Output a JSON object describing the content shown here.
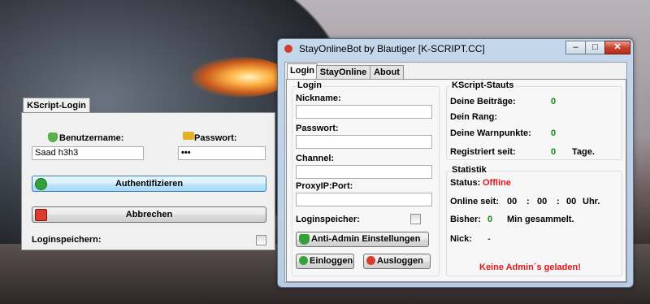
{
  "login_dialog": {
    "tab": "KScript-Login",
    "username_label": "Benutzername:",
    "username_value": "Saad h3h3",
    "password_label": "Passwort:",
    "password_value": "•••",
    "auth_button": "Authentifizieren",
    "cancel_button": "Abbrechen",
    "remember_label": "Loginspeichern:"
  },
  "bot_window": {
    "title": "StayOnlineBot by Blautiger [K-SCRIPT.CC]",
    "controls": {
      "minimize": "–",
      "maximize": "□",
      "close": "✕"
    },
    "tabs": [
      "Login",
      "StayOnline",
      "About"
    ],
    "login_group": {
      "title": "Login",
      "nickname_label": "Nickname:",
      "password_label": "Passwort:",
      "channel_label": "Channel:",
      "proxy_label": "ProxyIP:Port:",
      "remember_label": "Loginspeicher:",
      "anti_admin_button": "Anti-Admin Einstellungen",
      "login_button": "Einloggen",
      "logout_button": "Ausloggen"
    },
    "status_group": {
      "title": "KScript-Stauts",
      "posts_label": "Deine Beiträge:",
      "posts_value": "0",
      "rank_label": "Dein Rang:",
      "warn_label": "Deine Warnpunkte:",
      "warn_value": "0",
      "registered_label": "Registriert seit:",
      "registered_value": "0",
      "registered_unit": "Tage."
    },
    "stats_group": {
      "title": "Statistik",
      "status_label": "Status:",
      "status_value": "Offline",
      "online_label": "Online seit:",
      "online_h": "00",
      "online_m": "00",
      "online_s": "00",
      "online_unit": "Uhr.",
      "sep": ":",
      "collected_label": "Bisher:",
      "collected_value": "0",
      "collected_unit": "Min gesammelt.",
      "nick_label": "Nick:",
      "nick_value": "-",
      "admin_message": "Keine Admin´s geladen!"
    }
  },
  "colors": {
    "green": "#118a11",
    "red": "#e2161b",
    "accent": "#3c7fb1"
  },
  "icons": [
    "user-icon",
    "key-icon",
    "check-icon",
    "cancel-icon",
    "shield-icon",
    "app-icon"
  ]
}
